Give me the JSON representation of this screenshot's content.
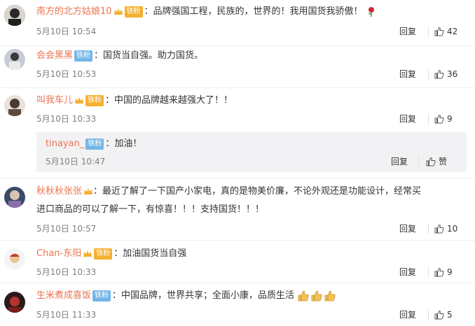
{
  "comments": [
    {
      "username": "南方的北方姑娘10",
      "badge": "铁粉",
      "text": "：品牌强国工程，民族的，世界的！我用国货我骄傲！",
      "time": "5月10日 10:54",
      "reply_label": "回复",
      "likes": "42",
      "trailing_emoji": "rose-icon"
    },
    {
      "username": "会会黑黑",
      "badge": "铁粉",
      "text": "：国货当自强。助力国货。",
      "time": "5月10日 10:53",
      "reply_label": "回复",
      "likes": "36"
    },
    {
      "username": "叫我车儿",
      "badge": "铁粉",
      "text": "：中国的品牌越来越强大了！！",
      "time": "5月10日 10:33",
      "reply_label": "回复",
      "likes": "9",
      "sub_reply": {
        "username": "tinayan_",
        "badge": "铁粉",
        "text": "：加油！",
        "time": "5月10日 10:47",
        "reply_label": "回复",
        "like_label": "赞"
      }
    },
    {
      "username": "秋秋秋张张",
      "text_line1": "：最近了解了一下国产小家电，真的是物美价廉，不论外观还是功能设计，经常买",
      "text_line2": "进口商品的可以了解一下，有惊喜！！！支持国货！！！",
      "time": "5月10日 10:57",
      "reply_label": "回复",
      "likes": "10"
    },
    {
      "username": "Chan-东阳",
      "badge": "铁粉",
      "text": "：加油国货当自强",
      "time": "5月10日 10:33",
      "reply_label": "回复",
      "likes": "9"
    },
    {
      "username": "生米煮成喜饭",
      "badge": "铁粉",
      "text": "：中国品牌，世界共享；全面小康，品质生活",
      "time": "5月10日 11:33",
      "reply_label": "回复",
      "likes": "5",
      "trailing_emoji": "thumbs-up-icon"
    }
  ],
  "colors": {
    "username": "#eb7350",
    "text": "#333333",
    "time": "#808080",
    "badge_gold": "#f5b031",
    "badge_blue": "#74b6e6",
    "sub_reply_bg": "#f2f2f5"
  }
}
